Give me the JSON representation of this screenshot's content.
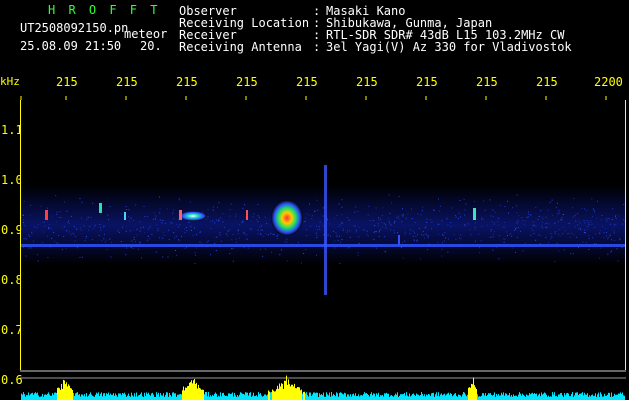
{
  "header": {
    "brand": "H R O F F T",
    "file_id": "UT2508092150.pn",
    "mode": "meteor",
    "datetime": "25.08.09 21:50",
    "datetime_tail": "20.",
    "info": [
      {
        "label": "Observer",
        "sep": ":",
        "value": "Masaki Kano"
      },
      {
        "label": "Receiving Location",
        "sep": ":",
        "value": "Shibukawa, Gunma, Japan"
      },
      {
        "label": "Receiver",
        "sep": ":",
        "value": "RTL-SDR SDR# 43dB L15 103.2MHz CW"
      },
      {
        "label": "Receiving Antenna",
        "sep": ":",
        "value": "3el Yagi(V) Az 330 for Vladivostok"
      }
    ]
  },
  "x_ticks": [
    "215",
    "215",
    "215",
    "215",
    "215",
    "215",
    "215",
    "215",
    "215",
    "2200"
  ],
  "y_axis": {
    "unit": "kHz",
    "ticks": [
      "1.1",
      "1.0",
      "0.9",
      "0.8",
      "0.7",
      "0.6"
    ]
  },
  "colors": {
    "background": "#000000",
    "text": "#ffffff",
    "brand": "#33ff33",
    "axis": "#ffff00",
    "signal_base": "#1a2bd6",
    "signal_hot": "#ff2020",
    "histogram": "#00e5ff",
    "histogram_peak": "#ffff00"
  }
}
